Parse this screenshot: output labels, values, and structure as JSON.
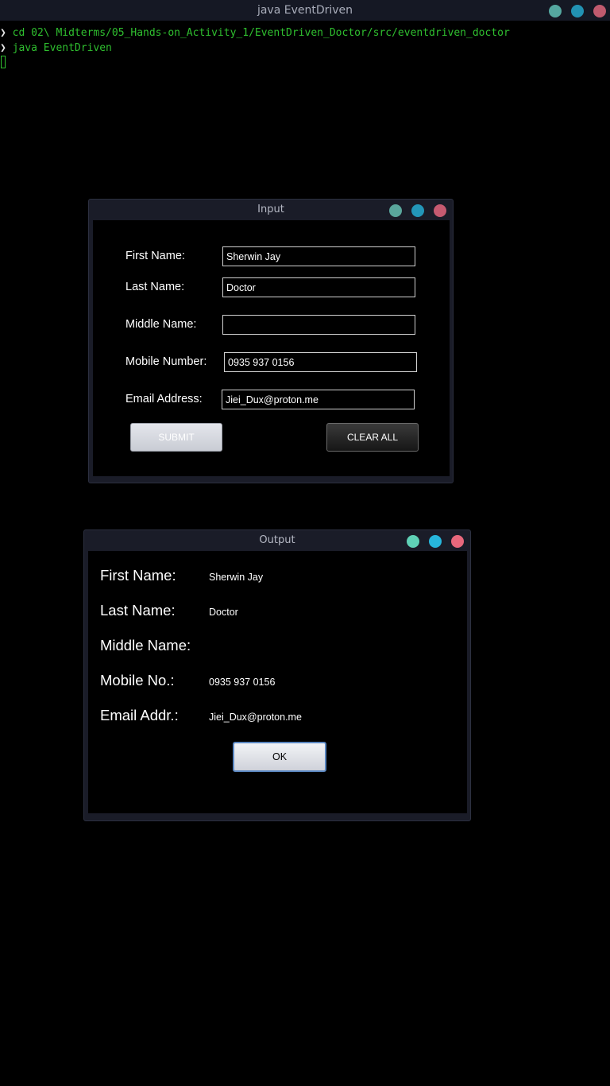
{
  "terminal": {
    "window_title": "java EventDriven",
    "prompt_symbol": "❯",
    "lines": [
      "cd 02\\ Midterms/05_Hands-on_Activity_1/EventDriven_Doctor/src/eventdriven_doctor",
      "java EventDriven"
    ]
  },
  "input_window": {
    "title": "Input",
    "labels": {
      "first_name": "First Name:",
      "last_name": "Last Name:",
      "middle_name": "Middle Name:",
      "mobile_number": "Mobile Number:",
      "email_address": "Email Address:"
    },
    "values": {
      "first_name": "Sherwin Jay",
      "last_name": "Doctor",
      "middle_name": "",
      "mobile_number": "0935 937 0156",
      "email_address": "Jiei_Dux@proton.me"
    },
    "buttons": {
      "submit": "SUBMIT",
      "clear_all": "CLEAR ALL"
    }
  },
  "output_window": {
    "title": "Output",
    "labels": {
      "first_name": "First Name:",
      "last_name": "Last Name:",
      "middle_name": "Middle Name:",
      "mobile_no": "Mobile No.:",
      "email_addr": "Email Addr.:"
    },
    "values": {
      "first_name": "Sherwin Jay",
      "last_name": "Doctor",
      "middle_name": "",
      "mobile_no": "0935 937 0156",
      "email_addr": "Jiei_Dux@proton.me"
    },
    "buttons": {
      "ok": "OK"
    }
  },
  "colors": {
    "terminal_text": "#2fbf2f",
    "titlebar": "#151824",
    "window_frame": "#1a1c28"
  }
}
